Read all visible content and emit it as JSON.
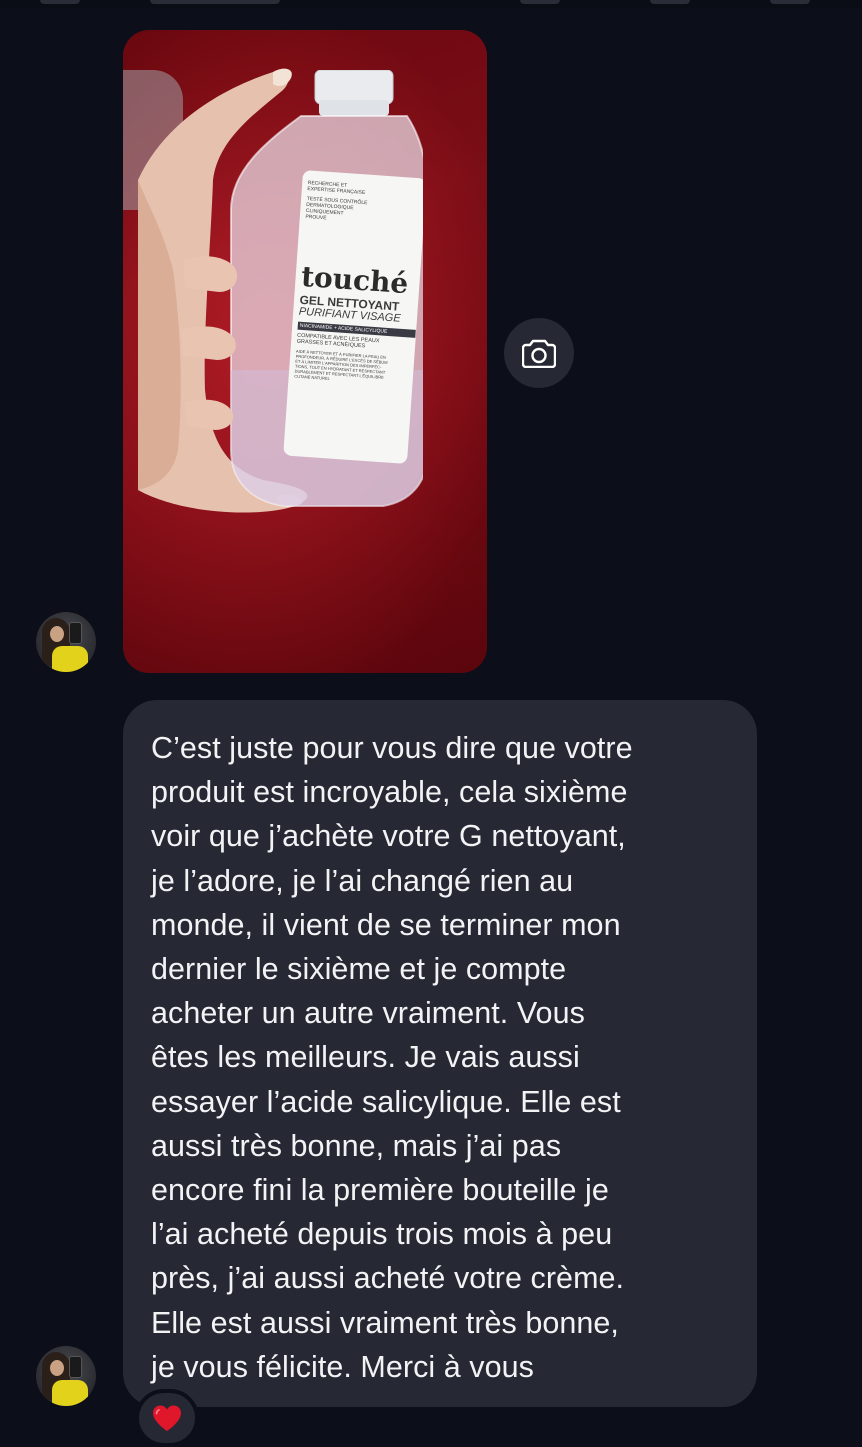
{
  "conversation": {
    "photo_message": {
      "alt": "Hand holding a bottle of touché Gel Nettoyant Purifiant Visage against a red background",
      "bottle_label": {
        "header": [
          "RECHERCHE ET",
          "EXPERTISE FRANÇAISE"
        ],
        "test_lines": [
          "TESTÉ SOUS CONTRÔLE",
          "DERMATOLOGIQUE",
          "CLINIQUEMENT",
          "PROUVÉ"
        ],
        "brand": "touché",
        "product_line1": "GEL NETTOYANT",
        "product_line2": "PURIFIANT VISAGE",
        "ingredients": "NIACINAMIDE + ACIDE SALICYLIQUE",
        "compat_line1": "COMPATIBLE AVEC LES PEAUX",
        "compat_line2": "GRASSES ET ACNÉIQUES",
        "description": [
          "AIDE À NETTOYER ET À PURIFIER LA PEAU EN",
          "PROFONDEUR, À RÉDUIRE L'EXCÈS DE SÉBUM",
          "ET À LIMITER L'APPARITION DES IMPERFEC-",
          "TIONS, TOUT EN HYDRATANT ET RESPECTANT",
          "DURABLEMENT ET RESPECTANT L'ÉQUILIBRE",
          "CUTANÉ NATUREL"
        ]
      }
    },
    "camera_button_icon": "camera-icon",
    "text_message": {
      "lines": [
        "C’est juste pour vous dire que votre",
        "produit est incroyable, cela sixième",
        "voir que j’achète votre G nettoyant,",
        "je l’adore, je l’ai changé rien au",
        "monde, il vient de se terminer mon",
        "dernier le sixième et je compte",
        "acheter un autre vraiment. Vous",
        "êtes les meilleurs. Je vais aussi",
        "essayer l’acide salicylique. Elle est",
        "aussi très bonne, mais j’ai pas",
        "encore fini la première bouteille je",
        "l’ai acheté depuis trois mois à peu",
        "près, j’ai aussi acheté votre crème.",
        "Elle est aussi vraiment très bonne,",
        "je vous félicite. Merci à vous"
      ]
    },
    "reaction_icon": "red-heart-icon",
    "colors": {
      "background": "#0c0e19",
      "bubble": "#262833",
      "text": "#f2f3f5",
      "heart": "#e0162b"
    }
  }
}
